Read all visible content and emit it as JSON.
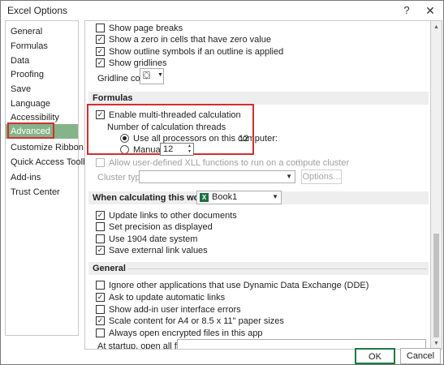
{
  "window": {
    "title": "Excel Options",
    "help": "?",
    "close": "✕"
  },
  "sidebar": {
    "items": [
      {
        "label": "General"
      },
      {
        "label": "Formulas"
      },
      {
        "label": "Data"
      },
      {
        "label": "Proofing"
      },
      {
        "label": "Save"
      },
      {
        "label": "Language"
      },
      {
        "label": "Accessibility"
      },
      {
        "label": "Advanced"
      },
      {
        "label": "Customize Ribbon"
      },
      {
        "label": "Quick Access Toolbar"
      },
      {
        "label": "Add-ins"
      },
      {
        "label": "Trust Center"
      }
    ],
    "selected": "Advanced"
  },
  "display": {
    "show_page_breaks": {
      "label": "Show page breaks",
      "checked": false
    },
    "show_zero": {
      "label": "Show a zero in cells that have zero value",
      "checked": true
    },
    "show_outline": {
      "label": "Show outline symbols if an outline is applied",
      "checked": true
    },
    "show_gridlines": {
      "label": "Show gridlines",
      "checked": true
    },
    "gridline_color_label": "Gridline color"
  },
  "formulas": {
    "section_title": "Formulas",
    "multithreaded": {
      "label": "Enable multi-threaded calculation",
      "checked": true
    },
    "threads_label": "Number of calculation threads",
    "use_all": {
      "label": "Use all processors on this computer:",
      "value": "12",
      "selected": true
    },
    "manual": {
      "label": "Manual",
      "value": "12",
      "selected": false
    },
    "cluster_functions": {
      "label": "Allow user-defined XLL functions to run on a compute cluster",
      "checked": false
    },
    "cluster_type_label": "Cluster type:",
    "options_button": "Options..."
  },
  "workbook": {
    "section_title": "When calculating this workbook:",
    "selected_workbook": "Book1",
    "update_links": {
      "label": "Update links to other documents",
      "checked": true
    },
    "precision": {
      "label": "Set precision as displayed",
      "checked": false
    },
    "date_1904": {
      "label": "Use 1904 date system",
      "checked": false
    },
    "save_links": {
      "label": "Save external link values",
      "checked": true
    }
  },
  "general": {
    "section_title": "General",
    "ignore_dde": {
      "label": "Ignore other applications that use Dynamic Data Exchange (DDE)",
      "checked": false
    },
    "ask_update": {
      "label": "Ask to update automatic links",
      "checked": true
    },
    "show_addin_errors": {
      "label": "Show add-in user interface errors",
      "checked": false
    },
    "scale_content": {
      "label": "Scale content for A4 or 8.5 x 11\" paper sizes",
      "checked": true
    },
    "open_encrypted": {
      "label": "Always open encrypted files in this app",
      "checked": false
    },
    "startup_label": "At startup, open all files in:"
  },
  "footer": {
    "ok": "OK",
    "cancel": "Cancel"
  },
  "colors": {
    "accent_selected": "#86b48a",
    "highlight_red": "#d32f2f",
    "ok_border": "#1f7a45"
  }
}
